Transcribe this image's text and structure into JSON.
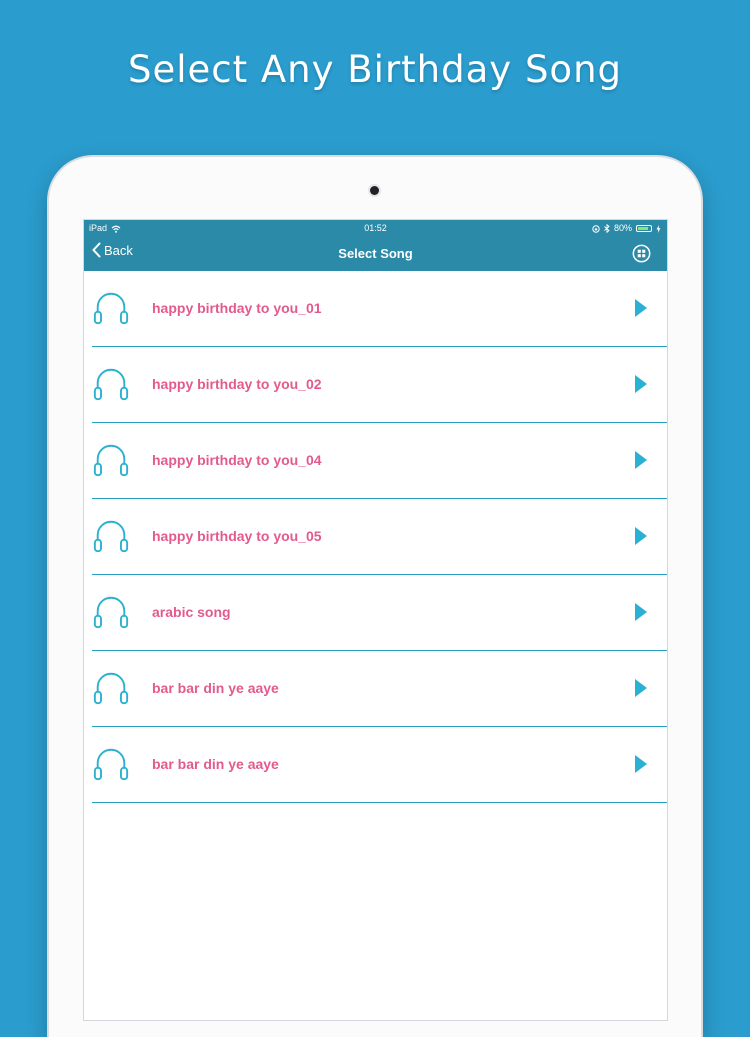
{
  "promo": {
    "title": "Select Any Birthday Song"
  },
  "status_bar": {
    "device": "iPad",
    "time": "01:52",
    "battery": "80%",
    "battery_level": 0.8
  },
  "nav": {
    "back_label": "Back",
    "title": "Select Song"
  },
  "songs": [
    {
      "title": "happy birthday to you_01"
    },
    {
      "title": "happy birthday to you_02"
    },
    {
      "title": "happy birthday to you_04"
    },
    {
      "title": "happy birthday to you_05"
    },
    {
      "title": "arabic song"
    },
    {
      "title": "bar bar din ye aaye"
    },
    {
      "title": "bar bar din ye aaye"
    }
  ],
  "colors": {
    "background": "#2a9ccd",
    "nav_bar": "#2a8aa8",
    "song_title": "#e35a8d",
    "accent": "#2ab0d0"
  },
  "icons": {
    "song_icon": "headphones-icon",
    "play_icon": "play-icon",
    "grid_icon": "grid-icon",
    "back_icon": "chevron-left-icon"
  }
}
